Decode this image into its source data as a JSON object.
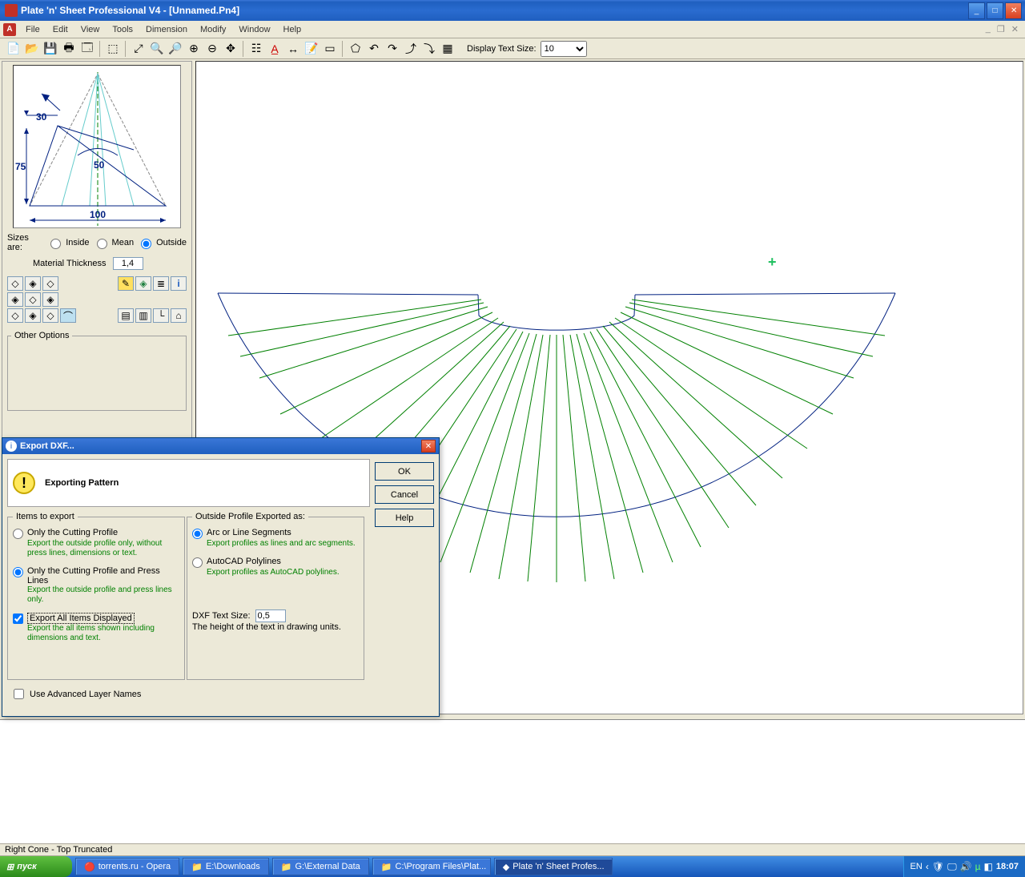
{
  "title": "Plate 'n' Sheet Professional V4 - [Unnamed.Pn4]",
  "menus": [
    "File",
    "Edit",
    "View",
    "Tools",
    "Dimension",
    "Modify",
    "Window",
    "Help"
  ],
  "textsize_label": "Display Text Size:",
  "textsize_value": "10",
  "sizes_are": "Sizes are:",
  "radio1": "Inside",
  "radio2": "Mean",
  "radio3": "Outside",
  "thickness_label": "Material Thickness",
  "thickness_value": "1,4",
  "other_options": "Other Options",
  "status": "Right Cone - Top Truncated",
  "preview_dims": {
    "a": "30",
    "b": "75",
    "c": "50",
    "d": "100"
  },
  "dialog": {
    "title": "Export DXF...",
    "header": "Exporting Pattern",
    "ok": "OK",
    "cancel": "Cancel",
    "help": "Help",
    "items_legend": "Items to export",
    "profile_legend": "Outside Profile Exported as:",
    "opt1": "Only the Cutting Profile",
    "opt1d": "Export the outside profile only, without press lines, dimensions or text.",
    "opt2": "Only the Cutting Profile and Press Lines",
    "opt2d": "Export the outside profile and press lines only.",
    "opt3": "Export All Items Displayed",
    "opt3d": "Export the all items shown including dimensions and text.",
    "optA": "Arc or Line Segments",
    "optAd": "Export profiles as lines and arc segments.",
    "optB": "AutoCAD Polylines",
    "optBd": "Export profiles as AutoCAD polylines.",
    "dxf_text_label": "DXF Text Size:",
    "dxf_text_value": "0,5",
    "dxf_text_desc": "The height of the text in drawing units.",
    "adv": "Use Advanced Layer Names"
  },
  "taskbar": {
    "start": "пуск",
    "items": [
      "torrents.ru - Opera",
      "E:\\Downloads",
      "G:\\External Data",
      "C:\\Program Files\\Plat...",
      "Plate 'n' Sheet Profes..."
    ],
    "lang": "EN",
    "clock": "18:07"
  }
}
